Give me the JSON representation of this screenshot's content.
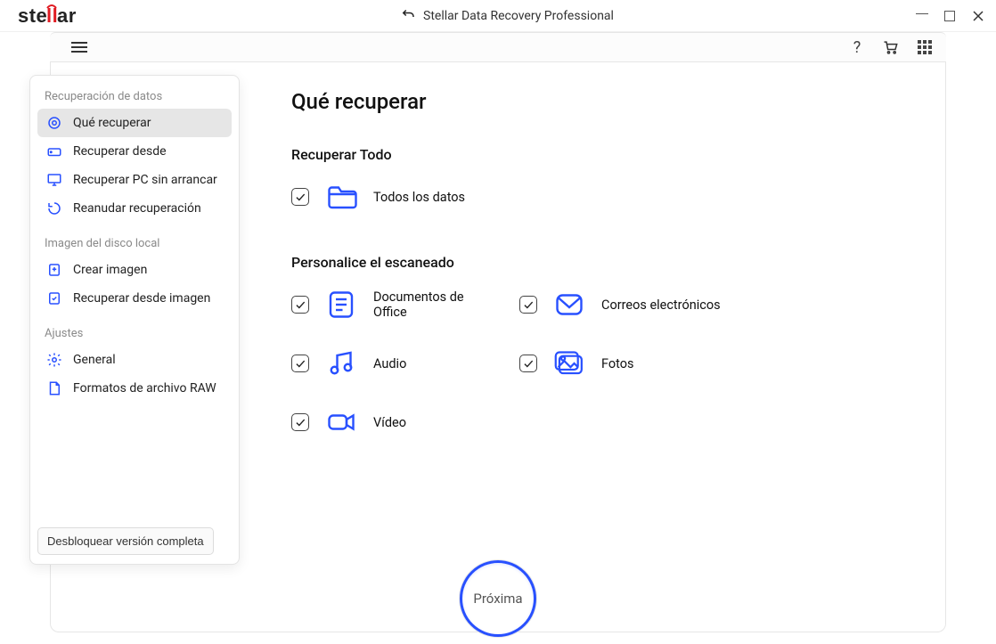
{
  "titlebar": {
    "app_title": "Stellar Data Recovery Professional",
    "logo_text": "stellar"
  },
  "sidebar": {
    "sections": [
      {
        "title": "Recuperación de datos",
        "items": [
          {
            "label": "Qué recuperar",
            "icon": "target-icon",
            "active": true
          },
          {
            "label": "Recuperar desde",
            "icon": "drive-icon"
          },
          {
            "label": "Recuperar PC sin arrancar",
            "icon": "monitor-icon"
          },
          {
            "label": "Reanudar recuperación",
            "icon": "resume-icon"
          }
        ]
      },
      {
        "title": "Imagen del disco local",
        "items": [
          {
            "label": "Crear imagen",
            "icon": "create-image-icon"
          },
          {
            "label": "Recuperar desde imagen",
            "icon": "recover-image-icon"
          }
        ]
      },
      {
        "title": "Ajustes",
        "items": [
          {
            "label": "General",
            "icon": "gear-icon"
          },
          {
            "label": "Formatos de archivo RAW",
            "icon": "raw-icon"
          }
        ]
      }
    ],
    "unlock_label": "Desbloquear versión completa"
  },
  "main": {
    "page_title": "Qué recuperar",
    "recover_all": {
      "section_title": "Recuperar Todo",
      "all_data": {
        "label": "Todos los datos",
        "checked": true
      }
    },
    "custom_scan": {
      "section_title": "Personalice el escaneado",
      "options": [
        {
          "label": "Documentos de Office",
          "icon": "doc-icon",
          "checked": true
        },
        {
          "label": "Correos electrónicos",
          "icon": "mail-icon",
          "checked": true
        },
        {
          "label": "Audio",
          "icon": "audio-icon",
          "checked": true
        },
        {
          "label": "Fotos",
          "icon": "photo-icon",
          "checked": true
        },
        {
          "label": "Vídeo",
          "icon": "video-icon",
          "checked": true
        }
      ]
    },
    "next_label": "Próxima"
  }
}
